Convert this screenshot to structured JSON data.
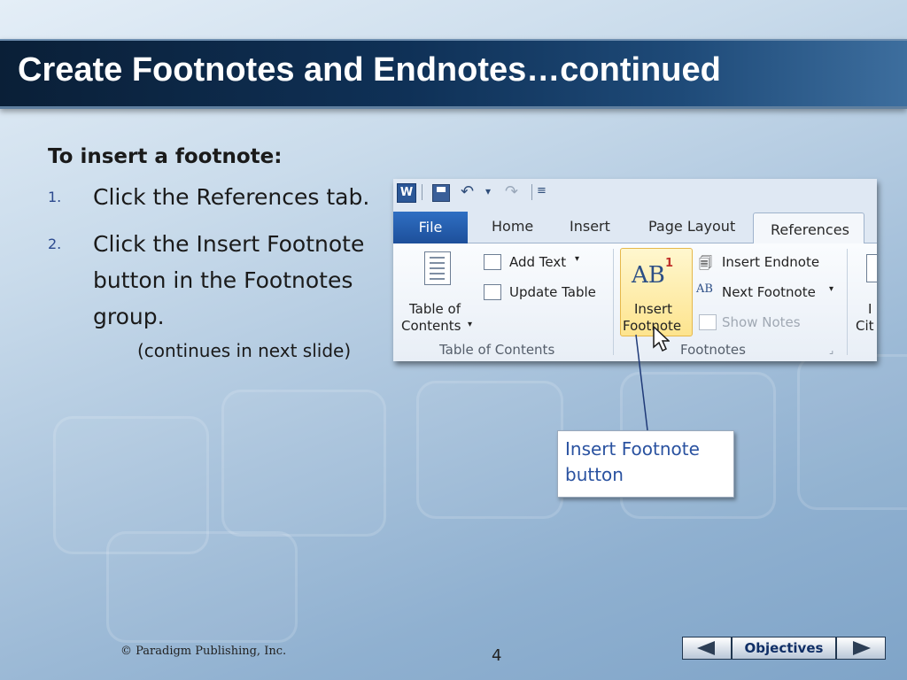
{
  "slide": {
    "title": "Create Footnotes and Endnotes…continued",
    "heading": "To insert a footnote:",
    "steps": [
      {
        "number": "1.",
        "text": "Click the References tab."
      },
      {
        "number": "2.",
        "text": "Click the Insert Footnote button in the Footnotes group."
      }
    ],
    "continues_note": "(continues in next slide)"
  },
  "ribbon": {
    "app_icon": "W",
    "qat_icons": [
      "save-icon",
      "undo-icon",
      "dropdown-icon",
      "redo-icon",
      "customize-qat-icon"
    ],
    "tabs": {
      "file": "File",
      "home": "Home",
      "insert": "Insert",
      "page_layout": "Page Layout",
      "references": "References"
    },
    "active_tab": "References",
    "toc": {
      "button_line1": "Table of",
      "button_line2": "Contents",
      "add_text": "Add Text",
      "update_table": "Update Table",
      "group_label": "Table of Contents"
    },
    "footnotes": {
      "insert_line1": "Insert",
      "insert_line2": "Footnote",
      "insert_endnote": "Insert Endnote",
      "next_footnote": "Next Footnote",
      "show_notes": "Show Notes",
      "group_label": "Footnotes",
      "ab_icon_text": "AB",
      "ab_superscript": "1"
    },
    "cut_off_labels": {
      "line1": "I",
      "line2": "Cit"
    }
  },
  "callout": {
    "text": "Insert Footnote button"
  },
  "footer": {
    "copyright": "© Paradigm Publishing, Inc.",
    "page_number": "4",
    "objectives_label": "Objectives"
  },
  "colors": {
    "title_bar": "#0f3157",
    "callout_text": "#2a52a0",
    "step_number": "#2c4a8f",
    "footnote_highlight": "#fde48e"
  }
}
